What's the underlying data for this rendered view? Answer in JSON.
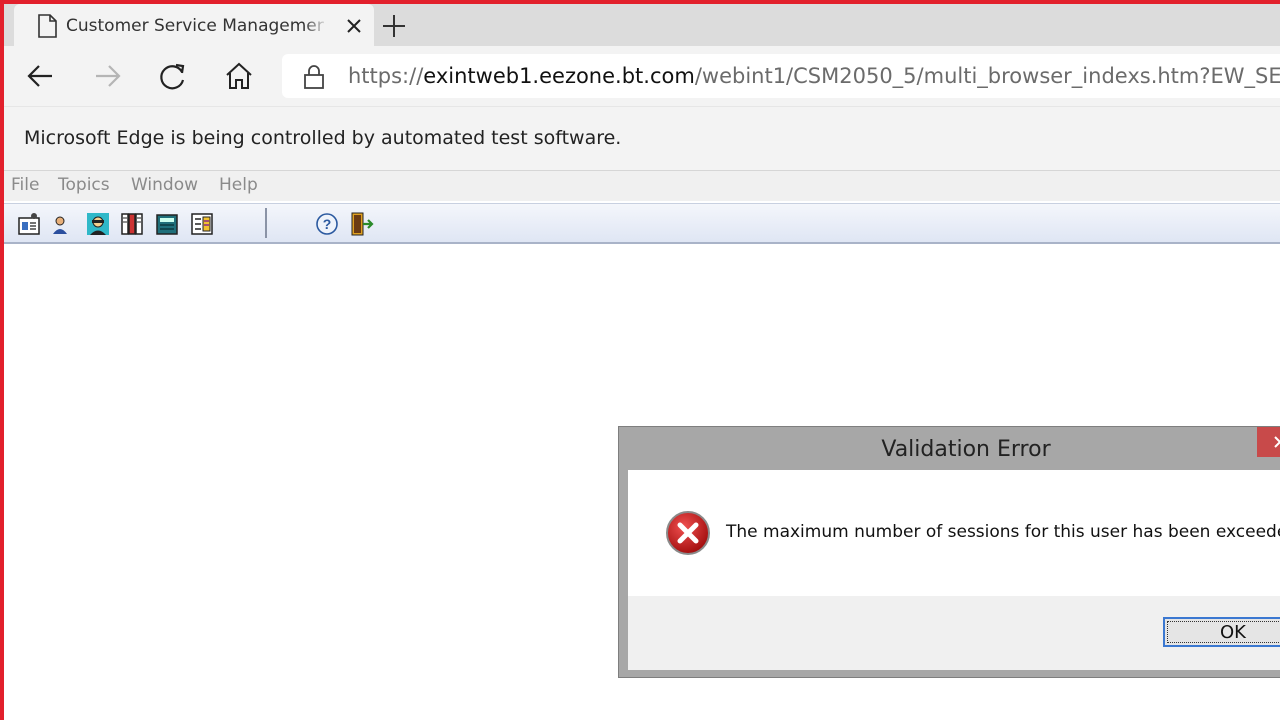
{
  "browser": {
    "tab": {
      "title": "Customer Service Management (",
      "icon": "page-icon",
      "close_icon": "close-icon"
    },
    "new_tab_icon": "plus-icon",
    "nav": {
      "back_icon": "back-arrow-icon",
      "forward_icon": "forward-arrow-icon",
      "refresh_icon": "refresh-icon",
      "home_icon": "home-icon"
    },
    "address": {
      "lock_icon": "lock-icon",
      "scheme": "https://",
      "domain": "exintweb1.eezone.bt.com",
      "path": "/webint1/CSM2050_5/multi_browser_indexs.htm?EW_SE"
    },
    "infobar_text": "Microsoft Edge is being controlled by automated test software."
  },
  "app": {
    "menu": [
      "File",
      "Topics",
      "Window",
      "Help"
    ],
    "toolbar": {
      "icons": [
        "customer-details-icon",
        "user-icon",
        "agent-icon",
        "books-icon",
        "calculator-icon",
        "notes-icon",
        "help-icon",
        "exit-icon"
      ]
    }
  },
  "dialog": {
    "title": "Validation Error",
    "message": "The maximum number of sessions for this user has been exceeded",
    "ok_label": "OK",
    "error_icon": "error-icon"
  },
  "colors": {
    "frame": "#e2202c",
    "dialog_border": "#a7a7a7",
    "focus": "#3b78d1"
  }
}
